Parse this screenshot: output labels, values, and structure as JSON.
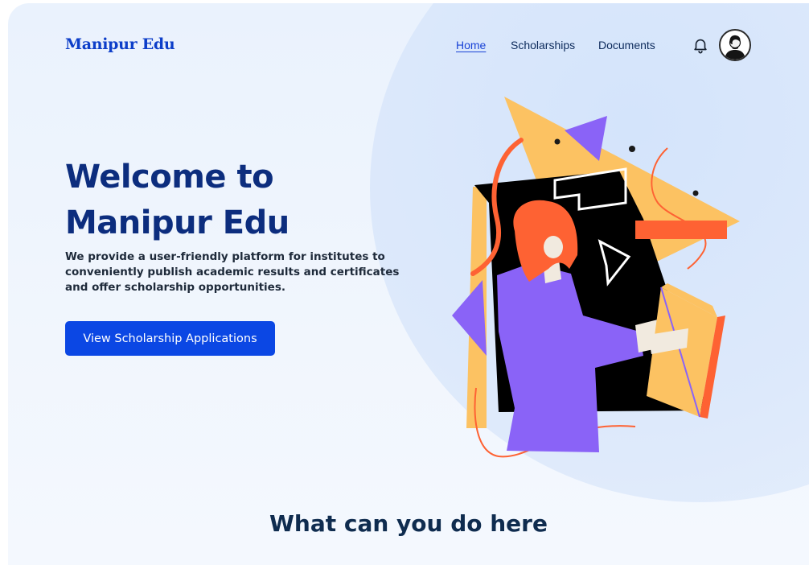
{
  "header": {
    "logo": "Manipur Edu",
    "nav": [
      {
        "label": "Home",
        "active": true
      },
      {
        "label": "Scholarships",
        "active": false
      },
      {
        "label": "Documents",
        "active": false
      }
    ],
    "icons": {
      "notifications": "bell-icon",
      "profile": "avatar"
    }
  },
  "hero": {
    "title_line1": "Welcome to",
    "title_line2": "Manipur Edu",
    "description": "We provide a user-friendly platform for institutes to conveniently publish academic results and certificates and offer scholarship opportunities.",
    "cta_label": "View Scholarship Applications"
  },
  "section": {
    "title": "What can you do here"
  },
  "colors": {
    "brand": "#0d3ec9",
    "button": "#0b47e4",
    "heading": "#0c2d7e",
    "accent_orange": "#fe6233",
    "accent_yellow": "#fcc262",
    "accent_purple": "#8a63f7"
  }
}
